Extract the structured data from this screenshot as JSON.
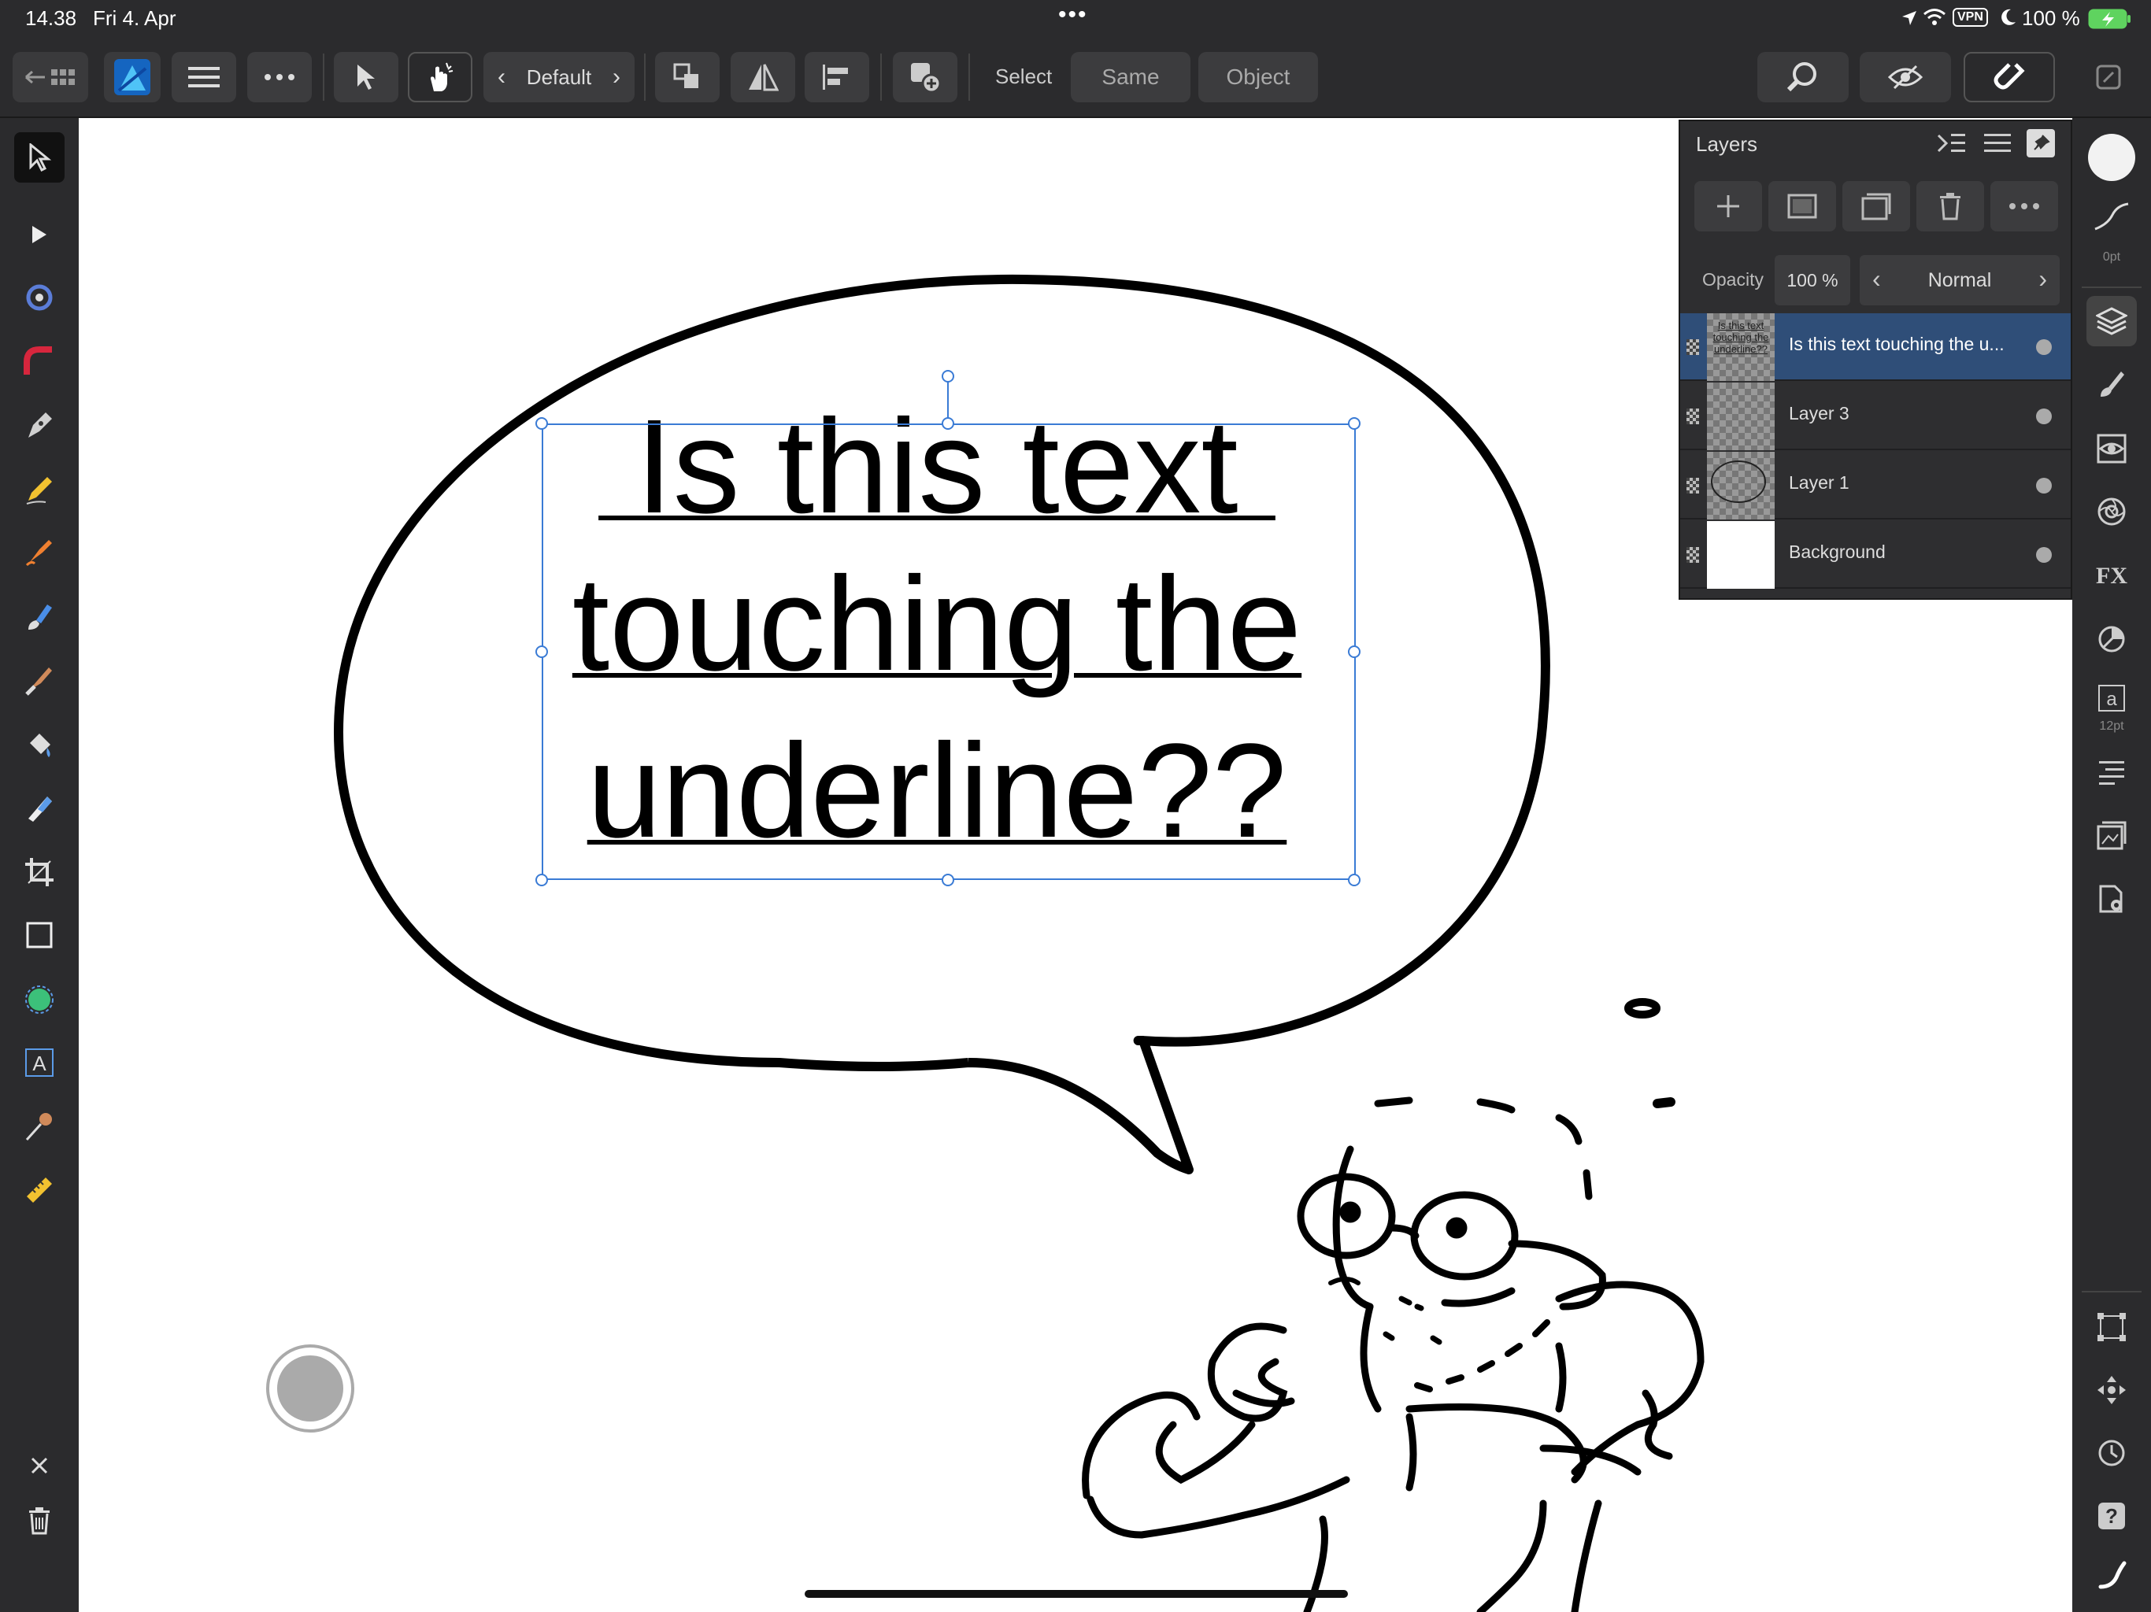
{
  "status_bar": {
    "time": "14.38",
    "date": "Fri 4. Apr",
    "battery": "100 %",
    "vpn": "VPN"
  },
  "toolbar": {
    "preset_label": "Default",
    "select_label": "Select",
    "same_label": "Same",
    "object_label": "Object"
  },
  "canvas": {
    "text_line1": " Is this text ",
    "text_line2": "touching the",
    "text_line3": "underline??"
  },
  "layers_panel": {
    "title": "Layers",
    "opacity_label": "Opacity",
    "opacity_value": "100 %",
    "blend_mode": "Normal",
    "layers": [
      {
        "name": "Is this text touching the u...",
        "selected": true
      },
      {
        "name": "Layer 3",
        "selected": false
      },
      {
        "name": "Layer 1",
        "selected": false
      },
      {
        "name": "Background",
        "selected": false
      }
    ],
    "thumb_text": "Is this text touching the underline??"
  },
  "right_bar": {
    "stroke_width": "0pt",
    "font_size": "12pt"
  },
  "colors": {
    "accent": "#3a6ab8",
    "selected_row": "#2f4e78",
    "panel_bg": "#2e2e30",
    "canvas_bg": "#ffffff"
  }
}
